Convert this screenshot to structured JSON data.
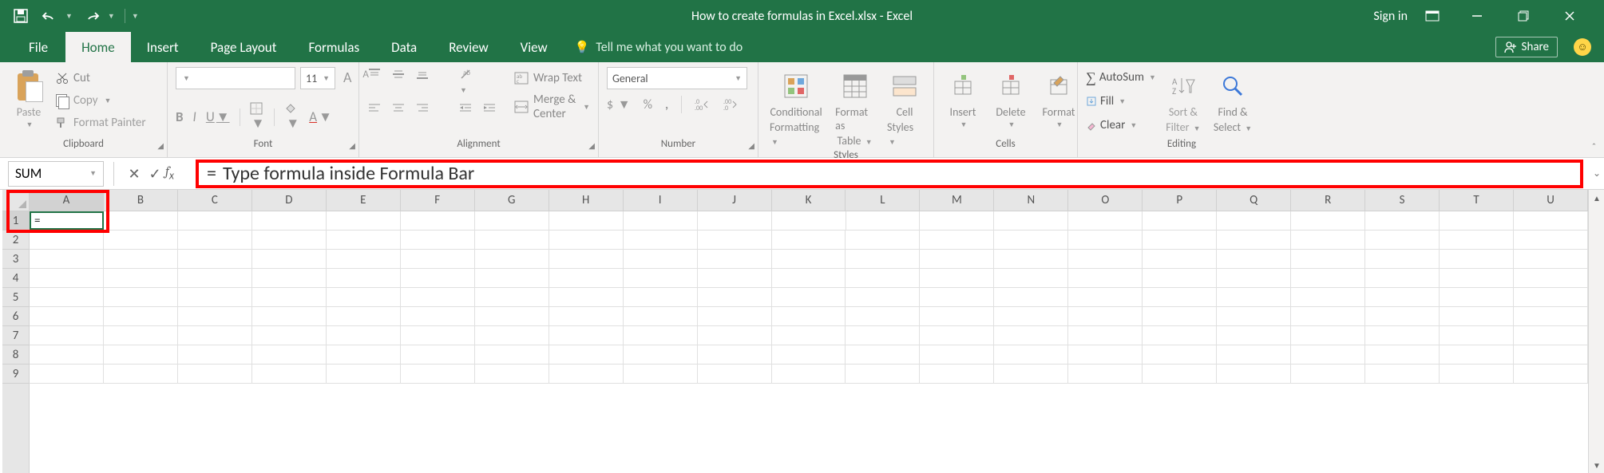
{
  "title": "How to create formulas in Excel.xlsx - Excel",
  "signin": "Sign in",
  "tabs": {
    "file": "File",
    "home": "Home",
    "insert": "Insert",
    "pagelayout": "Page Layout",
    "formulas": "Formulas",
    "data": "Data",
    "review": "Review",
    "view": "View",
    "tellme": "Tell me what you want to do"
  },
  "share": "Share",
  "ribbon": {
    "clipboard": {
      "label": "Clipboard",
      "paste": "Paste",
      "cut": "Cut",
      "copy": "Copy",
      "fp": "Format Painter"
    },
    "font": {
      "label": "Font",
      "size": "11",
      "b": "B",
      "i": "I",
      "u": "U",
      "aplus": "A",
      "aminus": "A"
    },
    "alignment": {
      "label": "Alignment",
      "wrap": "Wrap Text",
      "merge": "Merge & Center"
    },
    "number": {
      "label": "Number",
      "format": "General",
      "currency": "$",
      "pct": "%",
      "comma": ",",
      "incdec": ".0",
      "decdec": ".00"
    },
    "styles": {
      "label": "Styles",
      "cf": "Conditional",
      "cf2": "Formatting",
      "fat": "Format as",
      "fat2": "Table",
      "cs": "Cell",
      "cs2": "Styles"
    },
    "cells": {
      "label": "Cells",
      "insert": "Insert",
      "delete": "Delete",
      "format": "Format"
    },
    "editing": {
      "label": "Editing",
      "autosum": "AutoSum",
      "fill": "Fill",
      "clear": "Clear",
      "sort": "Sort &",
      "sort2": "Filter",
      "find": "Find &",
      "find2": "Select"
    }
  },
  "namebox": "SUM",
  "formula_display": "=  Type formula inside Formula Bar",
  "formula_eq": "=",
  "formula_text": "Type formula inside Formula Bar",
  "cell_a1": "=",
  "columns": [
    "A",
    "B",
    "C",
    "D",
    "E",
    "F",
    "G",
    "H",
    "I",
    "J",
    "K",
    "L",
    "M",
    "N",
    "O",
    "P",
    "Q",
    "R",
    "S",
    "T",
    "U"
  ],
  "rows": [
    "1",
    "2",
    "3",
    "4",
    "5",
    "6",
    "7",
    "8",
    "9"
  ]
}
